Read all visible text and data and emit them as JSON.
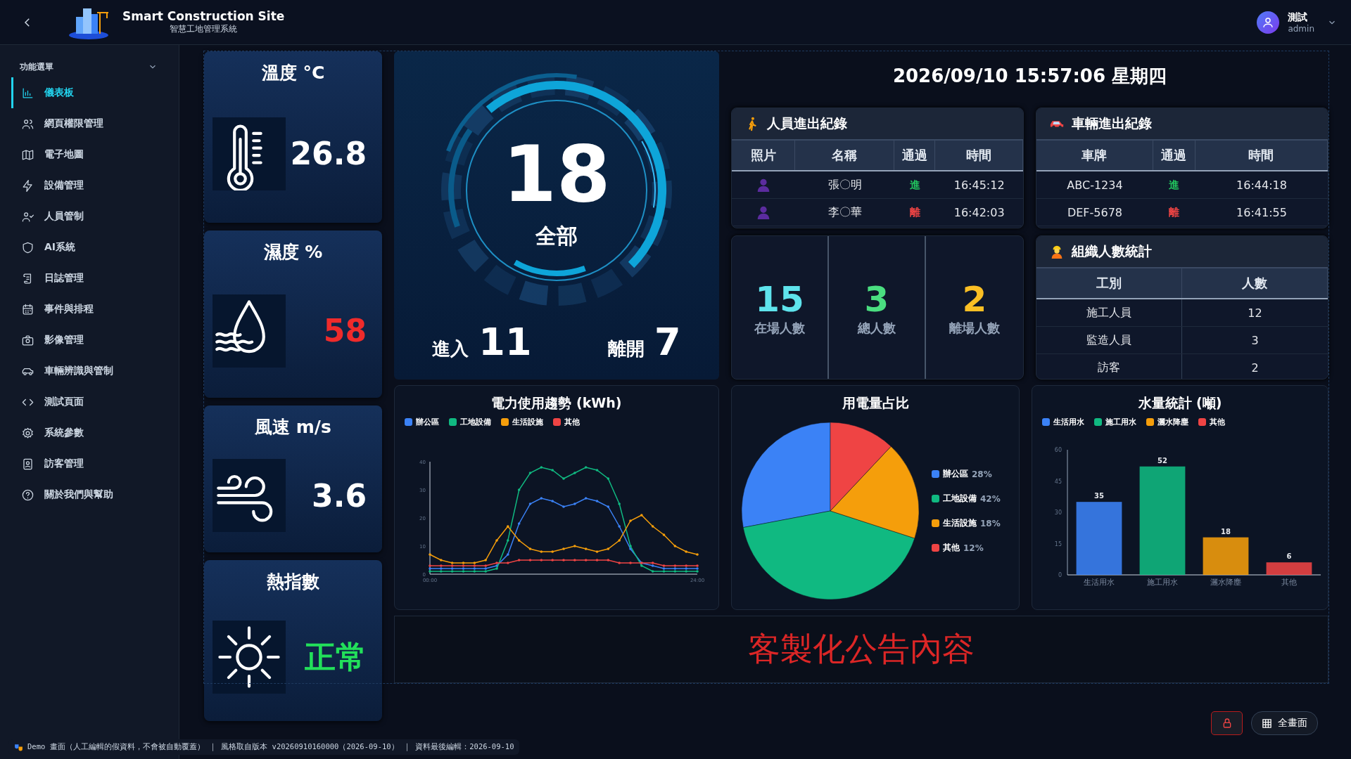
{
  "header": {
    "title": "Smart Construction Site",
    "subtitle": "智慧工地管理系統",
    "user": {
      "name": "測試",
      "role": "admin"
    }
  },
  "sidebar": {
    "heading": "功能選單",
    "expanded": true,
    "items": [
      {
        "label": "儀表板",
        "selected": true
      },
      {
        "label": "網頁權限管理",
        "selected": false
      },
      {
        "label": "電子地圖",
        "selected": false
      },
      {
        "label": "設備管理",
        "selected": false
      },
      {
        "label": "人員管制",
        "selected": false
      },
      {
        "label": "AI系統",
        "selected": false
      },
      {
        "label": "日誌管理",
        "selected": false
      },
      {
        "label": "事件與排程",
        "selected": false
      },
      {
        "label": "影像管理",
        "selected": false
      },
      {
        "label": "車輛辨識與管制",
        "selected": false
      },
      {
        "label": "測試頁面",
        "selected": false
      },
      {
        "label": "系統參數",
        "selected": false
      },
      {
        "label": "訪客管理",
        "selected": false
      },
      {
        "label": "關於我們與幫助",
        "selected": false
      }
    ]
  },
  "metrics": [
    {
      "title": "溫度 °C",
      "value": "26.8",
      "color": "#ffffff"
    },
    {
      "title": "濕度 %",
      "value": "58",
      "color": "#ef2b2b"
    },
    {
      "title": "風速 m/s",
      "value": "3.6",
      "color": "#ffffff"
    },
    {
      "title": "熱指數",
      "value": "正常",
      "color": "#22e05a"
    }
  ],
  "gauge": {
    "value": "18",
    "label": "全部",
    "in_label": "進入",
    "in_value": "11",
    "out_label": "離開",
    "out_value": "7"
  },
  "datetime": "2026/09/10 15:57:06 星期四",
  "people_log": {
    "title": "人員進出紀錄",
    "columns": [
      "照片",
      "名稱",
      "通過",
      "時間"
    ],
    "rows": [
      {
        "name": "張〇明",
        "pass": "進",
        "color": "#22c55e",
        "time": "16:45:12"
      },
      {
        "name": "李〇華",
        "pass": "離",
        "color": "#ef4444",
        "time": "16:42:03"
      }
    ]
  },
  "vehicle_log": {
    "title": "車輛進出紀錄",
    "columns": [
      "車牌",
      "通過",
      "時間"
    ],
    "rows": [
      {
        "plate": "ABC-1234",
        "pass": "進",
        "color": "#22c55e",
        "time": "16:44:18"
      },
      {
        "plate": "DEF-5678",
        "pass": "離",
        "color": "#ef4444",
        "time": "16:41:55"
      }
    ]
  },
  "stats": [
    {
      "value": "15",
      "label": "在場人數",
      "color": "#5ee3ec"
    },
    {
      "value": "3",
      "label": "總人數",
      "color": "#4ade80"
    },
    {
      "value": "2",
      "label": "離場人數",
      "color": "#fbbf24"
    }
  ],
  "org_stats": {
    "title": "組織人數統計",
    "columns": [
      "工別",
      "人數"
    ],
    "rows": [
      [
        "施工人員",
        "12"
      ],
      [
        "監造人員",
        "3"
      ],
      [
        "訪客",
        "2"
      ]
    ]
  },
  "power_chart": {
    "chart_data": {
      "type": "line",
      "title": "電力使用趨勢 (kWh)",
      "x": [
        0,
        1,
        2,
        3,
        4,
        5,
        6,
        7,
        8,
        9,
        10,
        11,
        12,
        13,
        14,
        15,
        16,
        17,
        18,
        19,
        20,
        21,
        22,
        23,
        24
      ],
      "xticks": [
        {
          "value": 0,
          "label": "00:00"
        },
        {
          "value": 24,
          "label": "24:00"
        }
      ],
      "xlim": [
        0,
        24
      ],
      "ylim": [
        0,
        40
      ],
      "yticks": [
        0,
        10,
        20,
        30,
        40
      ],
      "series": [
        {
          "name": "辦公區",
          "color": "#3b82f6",
          "values": [
            2,
            2,
            2,
            2,
            2,
            2,
            3,
            7,
            18,
            25,
            27,
            26,
            24,
            25,
            27,
            26,
            24,
            17,
            9,
            4,
            3,
            2,
            2,
            2,
            2
          ]
        },
        {
          "name": "工地設備",
          "color": "#10b981",
          "values": [
            1,
            1,
            1,
            1,
            1,
            1,
            2,
            12,
            30,
            36,
            38,
            37,
            34,
            36,
            38,
            37,
            34,
            25,
            10,
            3,
            1,
            1,
            1,
            1,
            1
          ]
        },
        {
          "name": "生活設施",
          "color": "#f59e0b",
          "values": [
            7,
            5,
            4,
            4,
            4,
            5,
            12,
            17,
            12,
            9,
            8,
            8,
            9,
            10,
            9,
            8,
            9,
            12,
            19,
            21,
            17,
            14,
            10,
            8,
            7
          ]
        },
        {
          "name": "其他",
          "color": "#ef4444",
          "values": [
            3,
            3,
            3,
            3,
            3,
            3,
            4,
            4,
            5,
            5,
            5,
            5,
            5,
            5,
            5,
            5,
            5,
            4,
            4,
            4,
            4,
            3,
            3,
            3,
            3
          ]
        }
      ]
    }
  },
  "usage_chart": {
    "chart_data": {
      "type": "pie",
      "title": "用電量占比",
      "categories": [
        "辦公區",
        "工地設備",
        "生活設施",
        "其他"
      ],
      "values": [
        28,
        42,
        18,
        12
      ]
    },
    "legend": [
      {
        "share": "28%",
        "color": "#3b82f6"
      },
      {
        "share": "42%",
        "color": "#10b981"
      },
      {
        "share": "18%",
        "color": "#f59e0b"
      },
      {
        "share": "12%",
        "color": "#ef4444"
      }
    ]
  },
  "water_chart": {
    "chart_data": {
      "type": "bar",
      "title": "水量統計 (噸)",
      "categories": [
        "生活用水",
        "施工用水",
        "灑水降塵",
        "其他"
      ],
      "values": [
        35,
        52,
        18,
        6
      ],
      "ylim": [
        0,
        60
      ],
      "yticks": [
        0,
        15,
        30,
        45,
        60
      ],
      "data_labels": true
    },
    "legend": [
      {
        "label": "生活用水",
        "color": "#3b82f6"
      },
      {
        "label": "施工用水",
        "color": "#10b981"
      },
      {
        "label": "灑水降塵",
        "color": "#f59e0b"
      },
      {
        "label": "其他",
        "color": "#ef4444"
      }
    ]
  },
  "announcement": "客製化公告內容",
  "fullscreen_button": "全畫面",
  "footer": "Demo 畫面（人工編輯的假資料，不會被自動覆蓋） ｜ 風格取自版本 v20260910160000（2026-09-10） ｜ 資料最後編輯：2026-09-10"
}
